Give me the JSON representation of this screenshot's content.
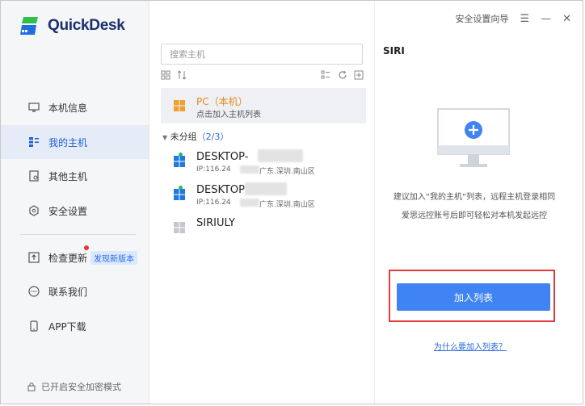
{
  "app": {
    "name": "QuickDesk"
  },
  "titlebar": {
    "guide": "安全设置向导"
  },
  "sidebar": {
    "items": [
      {
        "label": "本机信息",
        "icon": "computer-info-icon"
      },
      {
        "label": "我的主机",
        "icon": "my-hosts-icon"
      },
      {
        "label": "其他主机",
        "icon": "other-hosts-icon"
      },
      {
        "label": "安全设置",
        "icon": "shield-settings-icon"
      },
      {
        "label": "检查更新",
        "icon": "upload-icon",
        "badge": "发现新版本"
      },
      {
        "label": "联系我们",
        "icon": "chat-icon"
      },
      {
        "label": "APP下载",
        "icon": "phone-icon"
      }
    ],
    "secure_mode": "已开启安全加密模式"
  },
  "middle": {
    "search_placeholder": "搜索主机",
    "local_host": {
      "title": "PC（本机）",
      "subtitle": "点击加入主机列表"
    },
    "group": {
      "name": "未分组",
      "count": "（2/3）"
    },
    "hosts": [
      {
        "name": "DESKTOP-",
        "ip": "IP:116.24",
        "location": "广东.深圳.南山区",
        "online": true
      },
      {
        "name": "DESKTOP",
        "ip": "IP:116.24",
        "location": "广东.深圳.南山区",
        "online": true
      },
      {
        "name": "SIRIULY",
        "ip": "",
        "location": "",
        "online": false
      }
    ]
  },
  "right": {
    "title": "SIRI",
    "description_line1": "建议加入“我的主机”列表，远程主机登录相同",
    "description_line2": "爱思远控账号后即可轻松对本机发起远控",
    "add_button": "加入列表",
    "why_link": "为什么要加入列表？"
  },
  "colors": {
    "accent": "#3f84f2",
    "highlight_border": "#e23a3a",
    "local_host_text": "#e8891a",
    "online": "#1fbf5a"
  }
}
